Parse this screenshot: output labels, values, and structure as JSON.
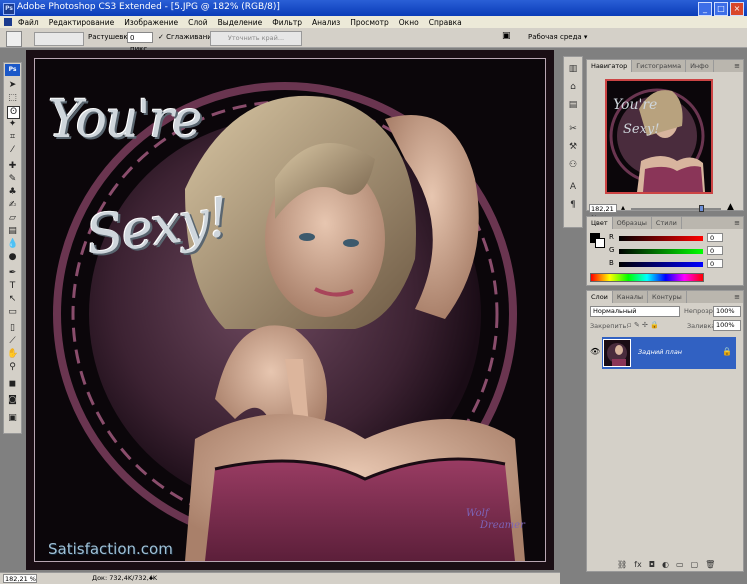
{
  "window": {
    "title": "Adobe Photoshop CS3 Extended - [5.JPG @ 182% (RGB/8)]",
    "app_icon": "Ps"
  },
  "menu": [
    "Файл",
    "Редактирование",
    "Изображение",
    "Слой",
    "Выделение",
    "Фильтр",
    "Анализ",
    "Просмотр",
    "Окно",
    "Справка"
  ],
  "options_bar": {
    "feather_label": "Растушевка:",
    "feather_value": "0 пикс",
    "antialias_label": "Сглаживание",
    "refine_edge_button": "Уточнить край...",
    "workspace_label": "Рабочая среда"
  },
  "toolbox": {
    "logo": "Ps"
  },
  "artwork": {
    "line1": "You're",
    "line2": "Sexy!",
    "website": "Satisfaction.com",
    "signature_1": "Wolf",
    "signature_2": "Dreamer"
  },
  "status": {
    "zoom": "182,21 %",
    "doc_info": "Док: 732,4K/732,4K"
  },
  "navigator": {
    "tabs": [
      "Навигатор",
      "Гистограмма",
      "Инфо"
    ],
    "zoom": "182,21 %"
  },
  "color_panel": {
    "tabs": [
      "Цвет",
      "Образцы",
      "Стили"
    ],
    "channels": [
      {
        "label": "R",
        "value": "0"
      },
      {
        "label": "G",
        "value": "0"
      },
      {
        "label": "B",
        "value": "0"
      }
    ]
  },
  "layers_panel": {
    "tabs": [
      "Слои",
      "Каналы",
      "Контуры"
    ],
    "blend_mode": "Нормальный",
    "opacity_label": "Непрозр.:",
    "opacity_value": "100%",
    "lock_label": "Закрепить:",
    "fill_label": "Заливка:",
    "fill_value": "100%",
    "layer_name": "Задний план"
  },
  "colors": {
    "title_blue": "#0a3cb8",
    "chrome": "#d4d0c8",
    "selection": "#3161c2",
    "frame_pink": "#7a3b5c"
  }
}
